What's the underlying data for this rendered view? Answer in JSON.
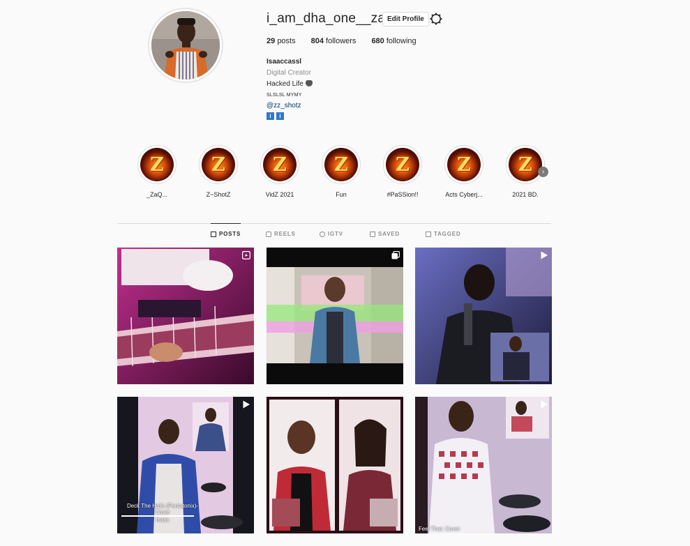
{
  "profile": {
    "username": "i_am_dha_one__zac",
    "edit_label": "Edit Profile",
    "stats": {
      "posts_count": "29",
      "posts_label": "posts",
      "followers_count": "804",
      "followers_label": "followers",
      "following_count": "680",
      "following_label": "following"
    },
    "bio": {
      "name": "Isaaccassl",
      "category": "Digital Creator",
      "line1": "Hacked Life",
      "line2": "SLSLSL MYMY",
      "link": "@zz_shotz",
      "emoji": [
        "i",
        "i"
      ]
    }
  },
  "highlights": [
    {
      "label": "_ZaQ...",
      "letter": "Z"
    },
    {
      "label": "Z~ShotZ",
      "letter": "Z"
    },
    {
      "label": "VidZ 2021",
      "letter": "Z"
    },
    {
      "label": "Fun",
      "letter": "Z"
    },
    {
      "label": "#PaSSion!!",
      "letter": "Z"
    },
    {
      "label": "Acts Cyberj...",
      "letter": "Z"
    },
    {
      "label": "2021 BD.",
      "letter": "Z"
    }
  ],
  "highlights_next_icon": "›",
  "tabs": [
    {
      "label": "POSTS",
      "icon": "grid-icon",
      "active": true
    },
    {
      "label": "REELS",
      "icon": "reels-icon",
      "active": false
    },
    {
      "label": "IGTV",
      "icon": "igtv-icon",
      "active": false
    },
    {
      "label": "SAVED",
      "icon": "saved-icon",
      "active": false
    },
    {
      "label": "TAGGED",
      "icon": "tagged-icon",
      "active": false
    }
  ],
  "posts": [
    {
      "type": "reel",
      "caption": ""
    },
    {
      "type": "carousel",
      "caption": ""
    },
    {
      "type": "video",
      "caption": ""
    },
    {
      "type": "video",
      "caption": "Deck The Halls (Pentatonix)- Cover",
      "caption2": "Isaac"
    },
    {
      "type": "video",
      "caption": ""
    },
    {
      "type": "video",
      "caption": "Feel That: Cover"
    }
  ],
  "colors": {
    "background": "#fafafa",
    "link": "#00376b",
    "muted": "#8e8e8e",
    "border": "#dbdbdb"
  }
}
